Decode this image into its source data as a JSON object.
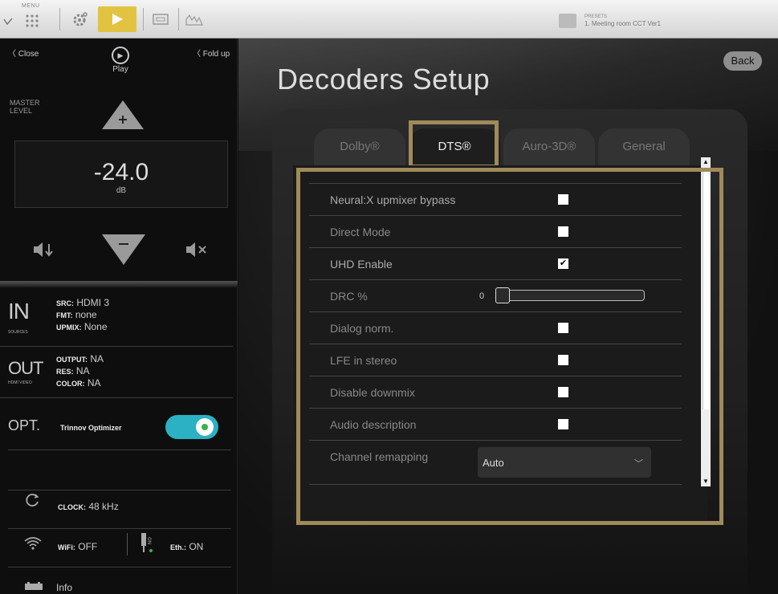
{
  "topbar": {
    "menu_label": "MENU",
    "presets_label": "PRESETS",
    "presets_value": "1. Meeting room CCT Ver1"
  },
  "sidebar": {
    "close_label": "Close",
    "play_label": "Play",
    "fold_label": "Fold up",
    "master_label": "MASTER LEVEL",
    "level_value": "-24.0",
    "level_unit": "dB",
    "in": {
      "big": "IN",
      "sub": "SOURCES",
      "src_key": "SRC:",
      "src_val": "HDMI 3",
      "fmt_key": "FMT:",
      "fmt_val": "none",
      "upmix_key": "UPMIX:",
      "upmix_val": "None"
    },
    "out": {
      "big": "OUT",
      "sub": "HDMI VIDEO",
      "output_key": "OUTPUT:",
      "output_val": "NA",
      "res_key": "RES:",
      "res_val": "NA",
      "color_key": "COLOR:",
      "color_val": "NA"
    },
    "opt": {
      "big": "OPT.",
      "name": "Trinnov Optimizer",
      "enabled": true
    },
    "clock_key": "CLOCK:",
    "clock_val": "48 kHz",
    "wifi_key": "WiFi:",
    "wifi_val": "OFF",
    "eth_icon_text": "ON",
    "eth_key": "Eth.:",
    "eth_val": "ON",
    "info_label": "Info"
  },
  "main": {
    "title": "Decoders Setup",
    "back_label": "Back",
    "tabs": [
      {
        "label": "Dolby®",
        "active": false
      },
      {
        "label": "DTS®",
        "active": true
      },
      {
        "label": "Auro-3D®",
        "active": false
      },
      {
        "label": "General",
        "active": false
      }
    ],
    "settings": [
      {
        "label": "Neural:X upmixer bypass",
        "type": "checkbox",
        "checked": false
      },
      {
        "label": "Direct Mode",
        "type": "checkbox",
        "checked": false
      },
      {
        "label": "UHD Enable",
        "type": "checkbox",
        "checked": true
      },
      {
        "label": "DRC %",
        "type": "slider",
        "value": "0"
      },
      {
        "label": "Dialog norm.",
        "type": "checkbox",
        "checked": false
      },
      {
        "label": "LFE in stereo",
        "type": "checkbox",
        "checked": false
      },
      {
        "label": "Disable downmix",
        "type": "checkbox",
        "checked": false
      },
      {
        "label": "Audio description",
        "type": "checkbox",
        "checked": false
      },
      {
        "label": "Channel remapping",
        "type": "select",
        "value": "Auto"
      }
    ]
  },
  "colors": {
    "accent_yellow": "#e1c341",
    "highlight_border": "#a08a5a",
    "toggle_on": "#2bb0c4",
    "toggle_dot": "#37b34a"
  }
}
